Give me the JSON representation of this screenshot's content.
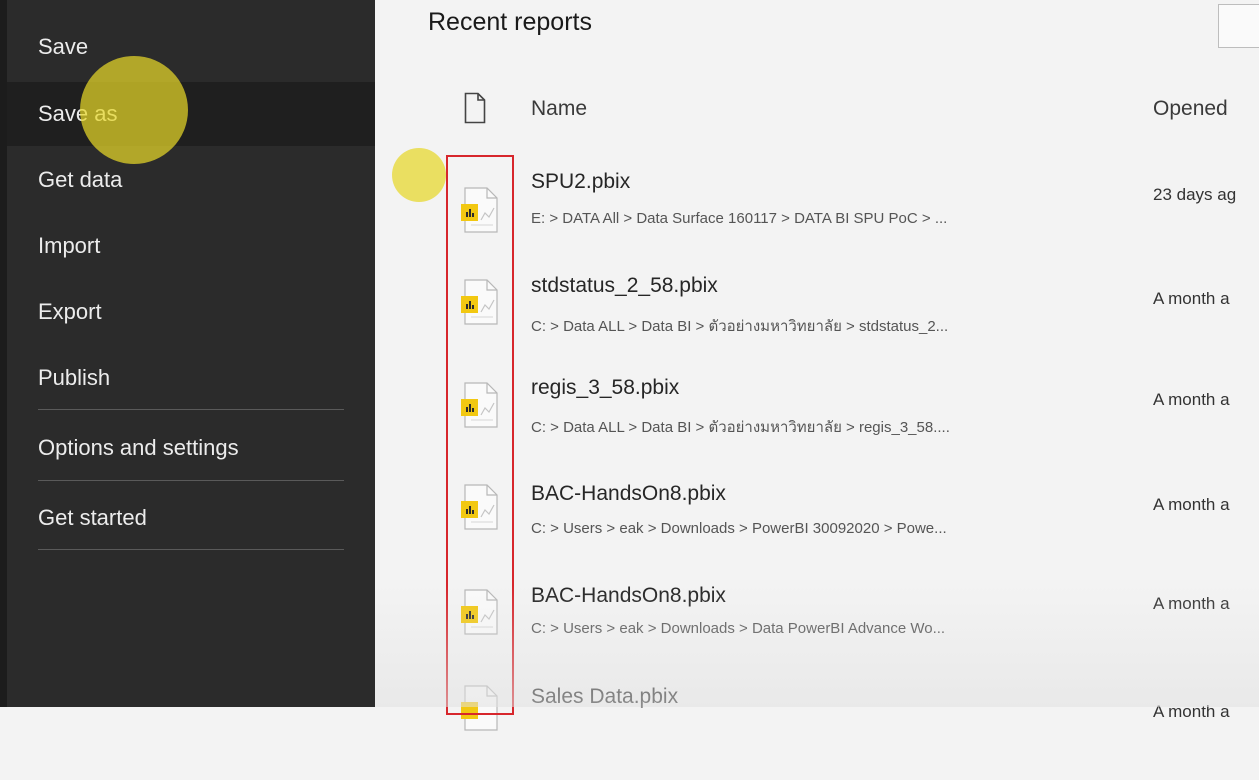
{
  "sidebar": {
    "items": [
      {
        "label": "Save"
      },
      {
        "label": "Save as"
      },
      {
        "label": "Get data"
      },
      {
        "label": "Import"
      },
      {
        "label": "Export"
      },
      {
        "label": "Publish"
      },
      {
        "label": "Options and settings"
      },
      {
        "label": "Get started"
      }
    ],
    "active_item": "Save as"
  },
  "main": {
    "title": "Recent reports",
    "columns": {
      "name": "Name",
      "opened": "Opened"
    },
    "rows": [
      {
        "name": "SPU2.pbix",
        "path": "E: > DATA All > Data Surface 160117 > DATA BI SPU PoC > ...",
        "opened": "23 days ag"
      },
      {
        "name": "stdstatus_2_58.pbix",
        "path": "C: > Data ALL > Data BI > ตัวอย่างมหาวิทยาลัย > stdstatus_2...",
        "opened": "A month a"
      },
      {
        "name": "regis_3_58.pbix",
        "path": "C: > Data ALL > Data BI > ตัวอย่างมหาวิทยาลัย > regis_3_58....",
        "opened": "A month a"
      },
      {
        "name": "BAC-HandsOn8.pbix",
        "path": "C: > Users > eak > Downloads > PowerBI 30092020 > Powe...",
        "opened": "A month a"
      },
      {
        "name": "BAC-HandsOn8.pbix",
        "path": "C: > Users > eak > Downloads > Data PowerBI Advance Wo...",
        "opened": "A month a"
      },
      {
        "name": "Sales Data.pbix",
        "path": "",
        "opened": "A month a"
      }
    ]
  },
  "icons": {
    "file_header": "file-outline-icon",
    "pbix": "pbix-file-icon"
  },
  "colors": {
    "sidebar_bg": "#2b2b2b",
    "active_item_bg": "#1f1f1f",
    "highlight_border": "#d7262c",
    "cursor_marker": "#e6d728",
    "pbix_accent": "#f2c811"
  }
}
